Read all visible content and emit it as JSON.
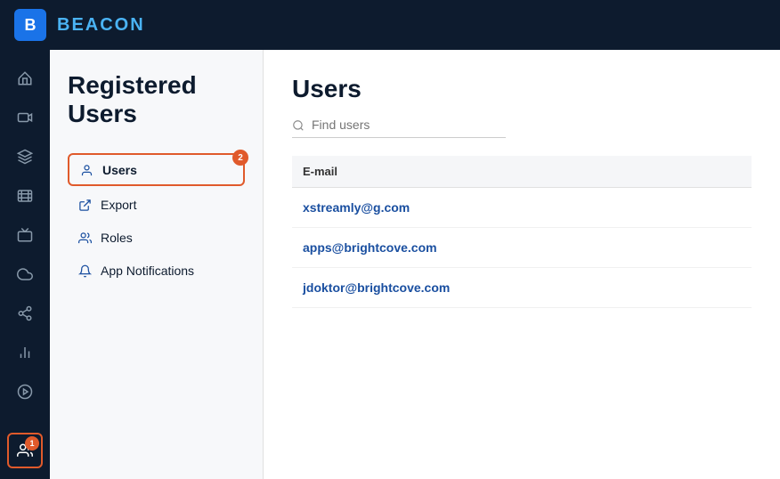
{
  "topbar": {
    "logo_text": "B",
    "title_text": "BEACON"
  },
  "icon_nav": {
    "items": [
      {
        "name": "home",
        "icon": "⌂",
        "active": false
      },
      {
        "name": "video",
        "icon": "▶",
        "active": false
      },
      {
        "name": "layers",
        "icon": "◧",
        "active": false
      },
      {
        "name": "film",
        "icon": "▭",
        "active": false
      },
      {
        "name": "tv",
        "icon": "⬜",
        "active": false
      },
      {
        "name": "cloud",
        "icon": "☁",
        "active": false
      },
      {
        "name": "share",
        "icon": "⋈",
        "active": false
      },
      {
        "name": "analytics",
        "icon": "▐",
        "active": false
      },
      {
        "name": "play-circle",
        "icon": "◎",
        "active": false
      },
      {
        "name": "users-bottom",
        "icon": "👤",
        "active": true,
        "badge": "1"
      }
    ]
  },
  "side_panel": {
    "title": "Registered Users",
    "nav_items": [
      {
        "name": "users",
        "label": "Users",
        "icon": "user",
        "active": true,
        "badge": "2"
      },
      {
        "name": "export",
        "label": "Export",
        "icon": "export",
        "active": false
      },
      {
        "name": "roles",
        "label": "Roles",
        "icon": "roles",
        "active": false
      },
      {
        "name": "app-notifications",
        "label": "App Notifications",
        "icon": "bell",
        "active": false
      }
    ]
  },
  "main": {
    "title": "Users",
    "search_placeholder": "Find users",
    "table": {
      "columns": [
        "E-mail"
      ],
      "rows": [
        {
          "email": "xstreamly@g.com"
        },
        {
          "email": "apps@brightcove.com"
        },
        {
          "email": "jdoktor@brightcove.com"
        }
      ]
    }
  }
}
